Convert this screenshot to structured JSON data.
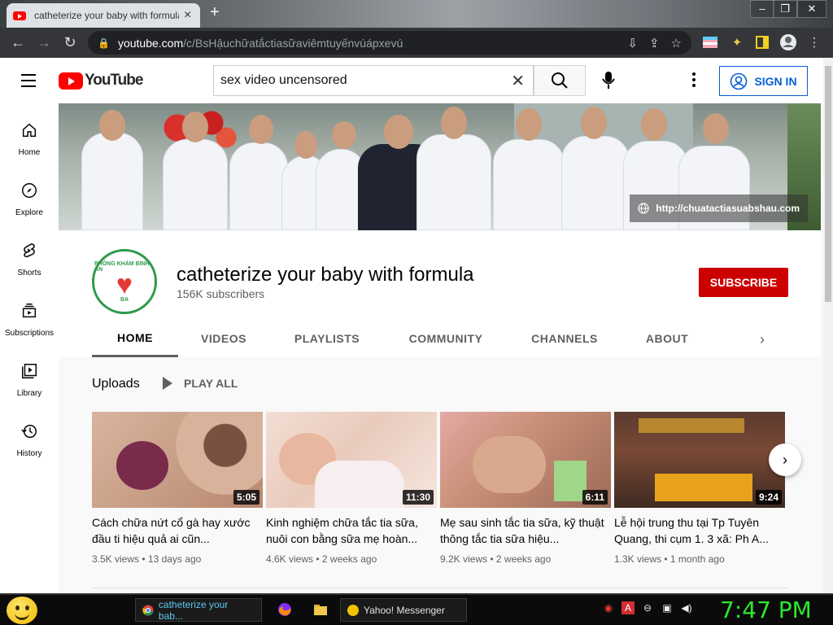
{
  "browser": {
    "tab_title": "catheterize your baby with formula",
    "url_host": "youtube.com",
    "url_path": "/c/BsHậuchữatắctiasữaviêmtuyếnvúápxevú"
  },
  "youtube": {
    "logo_text": "YouTube",
    "search_value": "sex video uncensored",
    "sign_in": "SIGN IN",
    "guide": [
      {
        "label": "Home",
        "icon": "home-icon"
      },
      {
        "label": "Explore",
        "icon": "compass-icon"
      },
      {
        "label": "Shorts",
        "icon": "shorts-icon"
      },
      {
        "label": "Subscriptions",
        "icon": "subscriptions-icon"
      },
      {
        "label": "Library",
        "icon": "library-icon"
      },
      {
        "label": "History",
        "icon": "history-icon"
      }
    ],
    "banner_link": "http://chuatactiasuabshau.com",
    "channel": {
      "name": "catheterize your baby with formula",
      "subscribers": "156K subscribers",
      "subscribe_label": "SUBSCRIBE",
      "avatar_text": "PHÒNG KHÁM BÌNH AN",
      "avatar_initials": "BA"
    },
    "tabs": [
      "HOME",
      "VIDEOS",
      "PLAYLISTS",
      "COMMUNITY",
      "CHANNELS",
      "ABOUT"
    ],
    "active_tab": "HOME",
    "section_title": "Uploads",
    "play_all": "PLAY ALL",
    "videos": [
      {
        "title": "Cách chữa nứt cổ gà hay xước đầu ti hiệu quả ai cũn...",
        "duration": "5:05",
        "views": "3.5K views",
        "age": "13 days ago",
        "thumb_color": "#c9a38d"
      },
      {
        "title": "Kinh nghiệm chữa tắc tia sữa, nuôi con bằng sữa mẹ hoàn...",
        "duration": "11:30",
        "views": "4.6K views",
        "age": "2 weeks ago",
        "thumb_color": "#e8cfc2"
      },
      {
        "title": "Mẹ sau sinh tắc tia sữa, kỹ thuật thông tắc tia sữa hiệu...",
        "duration": "6:11",
        "views": "9.2K views",
        "age": "2 weeks ago",
        "thumb_color": "#b98a74"
      },
      {
        "title": "Lễ hội trung thu tại Tp Tuyên Quang, thi cụm 1. 3 xã: Ph A...",
        "duration": "9:24",
        "views": "1.3K views",
        "age": "1 month ago",
        "thumb_color": "#6a3b2c"
      }
    ]
  },
  "taskbar": {
    "tasks": [
      "catheterize your bab...",
      "Yahoo! Messenger"
    ],
    "clock": "7:47 PM"
  },
  "colors": {
    "youtube_red": "#ff0000",
    "subscribe_red": "#cc0000",
    "link_blue": "#065fd4",
    "clock_green": "#2ee82e"
  }
}
